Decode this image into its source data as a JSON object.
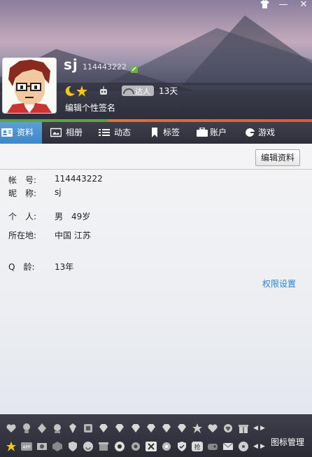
{
  "window": {
    "skin_icon": "shirt-icon",
    "minimize_icon": "minimize-icon",
    "close_icon": "close-icon",
    "minimize_glyph": "—",
    "close_glyph": "✕"
  },
  "profile": {
    "nickname": "sj",
    "qq_number": "114443222",
    "signature_prompt": "编辑个性签名",
    "daren_label": "达人",
    "days": "13天",
    "level_icons": [
      "moon-icon",
      "star-icon"
    ],
    "badge_icons": [
      "bot-icon",
      "daren-badge-icon"
    ]
  },
  "tabs": [
    {
      "label": "资料",
      "icon": "id-card-icon",
      "active": true
    },
    {
      "label": "相册",
      "icon": "photo-icon",
      "active": false
    },
    {
      "label": "动态",
      "icon": "feed-icon",
      "active": false
    },
    {
      "label": "标签",
      "icon": "bookmark-icon",
      "active": false
    },
    {
      "label": "账户",
      "icon": "wallet-icon",
      "active": false
    },
    {
      "label": "游戏",
      "icon": "game-icon",
      "active": false
    }
  ],
  "content": {
    "edit_button": "编辑资料",
    "fields": [
      {
        "label": "帐　号:",
        "value": "114443222"
      },
      {
        "label": "昵　称:",
        "value": "sj"
      },
      {
        "label": "个　人:",
        "value": "男　49岁"
      },
      {
        "label": "所在地:",
        "value": "中国 江苏"
      },
      {
        "label": "Q　龄:",
        "value": "13年"
      }
    ],
    "permission_link": "权限设置"
  },
  "bottom": {
    "row1_icons": [
      "heart-icon",
      "flower-icon",
      "pin-icon",
      "award-icon",
      "gem-icon",
      "pet-icon",
      "diamond-icon",
      "diamond-icon",
      "diamond-icon",
      "diamond-icon",
      "diamond-icon",
      "diamond-icon",
      "star-icon",
      "heart-badge-icon",
      "heart-badge-icon",
      "gift-icon"
    ],
    "row2_icons": [
      "star-icon",
      "app-icon",
      "photo-icon",
      "cube-icon",
      "shield-icon",
      "music-icon",
      "box-icon",
      "record-icon",
      "gear-icon",
      "flower-icon",
      "gem-icon",
      "shield-check-icon",
      "text-badge-icon",
      "game-icon",
      "mail-icon",
      "disc-icon"
    ],
    "app_text": "APP",
    "text_badge": "抢",
    "icon_manager": "图标管理",
    "arrow_left": "◀",
    "arrow_right": "▶"
  },
  "colors": {
    "tab_active": "#4a92cf",
    "accent_orange": "#e46b2a",
    "link_blue": "#2b7fd1"
  }
}
